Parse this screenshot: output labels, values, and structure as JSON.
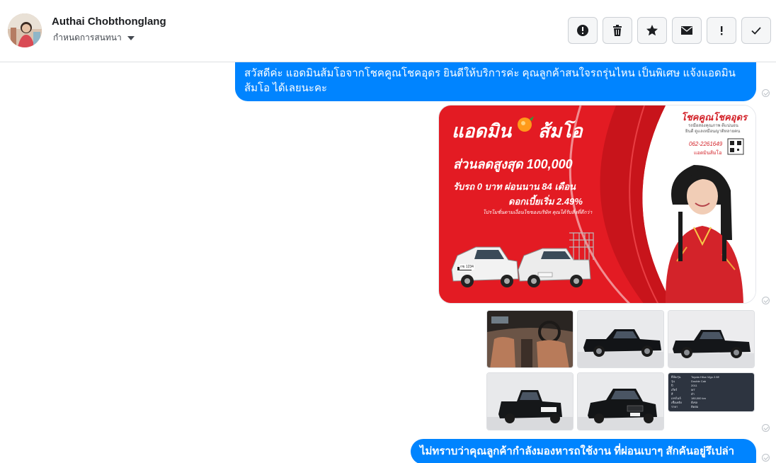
{
  "contact": {
    "name": "Authai Chobthonglang",
    "subtitle": "กำหนดการสนทนา"
  },
  "toolbar": {
    "buttons": [
      {
        "icon": "alert-circle-icon",
        "name": "spam-button"
      },
      {
        "icon": "trash-icon",
        "name": "delete-button"
      },
      {
        "icon": "star-icon",
        "name": "star-button"
      },
      {
        "icon": "envelope-icon",
        "name": "mark-unread-button"
      },
      {
        "icon": "exclamation-icon",
        "name": "follow-up-button"
      },
      {
        "icon": "check-icon",
        "name": "done-button"
      }
    ]
  },
  "messages": {
    "first": "สวัสดีค่ะ แอดมินส้มโอจากโชคคูณโชคอุดร ยินดีให้บริการค่ะ  คุณลูกค้าสนใจรถรุ่นไหน เป็นพิเศษ แจ้งแอดมินส้มโอ ได้เลยนะคะ",
    "last": "ไม่ทราบว่าคุณลูกค้ากำลังมองหารถใช้งาน ที่ผ่อนเบาๆ สักคันอยู่รึเปล่าคะ"
  },
  "promo": {
    "title_left": "แอดมิน",
    "title_right": "ส้มโอ",
    "discount": "ส่วนลดสูงสุด 100,000",
    "down": "รับรถ 0 บาท ผ่อนนาน 84 เดือน",
    "interest": "ดอกเบี้ยเริ่ม 2.49%",
    "fineprint": "โปรโมชั่นตามเงื่อนไขของบริษัท คุณได้รับสิ่งที่ดีกว่า",
    "brand": "โชคคูณโชคอุดร",
    "brand_sub": "รถมือสองคุณภาพ ดีแน่นอน",
    "brand_sub2": "ยินดี ดูแลเหมือนญาติหลายคน",
    "phone": "062-2261649",
    "admin": "แอดมินส้มโอ",
    "plate": "กข 1234"
  },
  "spec_card": {
    "rows": [
      [
        "ยี่ห้อ/รุ่น",
        "Toyota Hilux Vigo 2.5E"
      ],
      [
        "รุ่น",
        "Double Cab"
      ],
      [
        "ปี",
        "2011"
      ],
      [
        "เกียร์",
        "MT"
      ],
      [
        "สี",
        "ดำ"
      ],
      [
        "เลขไมล์",
        "180,000 km"
      ],
      [
        "เชื้อเพลิง",
        "ดีเซล"
      ],
      [
        "ราคา",
        "ติดต่อ"
      ]
    ]
  },
  "colors": {
    "bubble": "#0084ff",
    "promo_red": "#e31b23"
  }
}
